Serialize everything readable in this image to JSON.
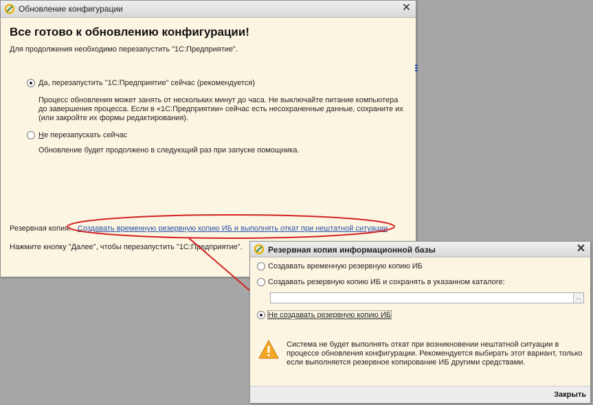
{
  "main_window": {
    "title": "Обновление конфигурации",
    "heading": "Все готово к обновлению конфигурации!",
    "intro": "Для продолжения необходимо перезапустить \"1С:Предприятие\".",
    "option1": {
      "hotkey": "Д",
      "label_rest": "а, перезапустить \"1С:Предприятие\" сейчас (рекомендуется)",
      "selected": true,
      "desc_lines": [
        "Процесс обновления может занять от нескольких минут до часа. Не выключайте питание компьютера",
        "до завершения процесса. Если в «1С:Предприятии» сейчас есть несохраненные данные, сохраните их",
        "(или закройте их формы редактирования)."
      ]
    },
    "option2": {
      "hotkey": "Н",
      "label_rest": "е перезапускать сейчас",
      "selected": false,
      "desc": "Обновление будет продолжено в следующий раз при запуске помощника."
    },
    "backup_label": "Резервная копия:",
    "backup_link": "Создавать временную резервную копию ИБ и выполнять откат при нештатной ситуации",
    "footer": "Нажмите кнопку \"Далее\", чтобы перезапустить \"1С:Предприятие\"."
  },
  "backup_dialog": {
    "title": "Резервная копия информационной базы",
    "options": [
      {
        "label": "Создавать временную резервную копию ИБ",
        "selected": false
      },
      {
        "label": "Создавать резервную копию ИБ и сохранять в указанном каталоге:",
        "selected": false
      },
      {
        "label": "Не создавать резервную копию ИБ",
        "selected": true
      }
    ],
    "path_value": "",
    "browse_label": "...",
    "warning_lines": [
      "Система не будет выполнять откат при возникновении нештатной ситуации в",
      "процессе обновления конфигурации. Рекомендуется выбирать этот вариант, только",
      "если выполняется резервное копирование ИБ другими средствами."
    ],
    "close_button": "Закрыть"
  },
  "icons": {
    "app": "1c-logo-icon",
    "close": "close-icon",
    "warning": "warning-icon"
  },
  "colors": {
    "link": "#2a4fa8",
    "highlight": "#d42020",
    "window_bg": "#fbf5e2",
    "warning": "#f5a623"
  }
}
